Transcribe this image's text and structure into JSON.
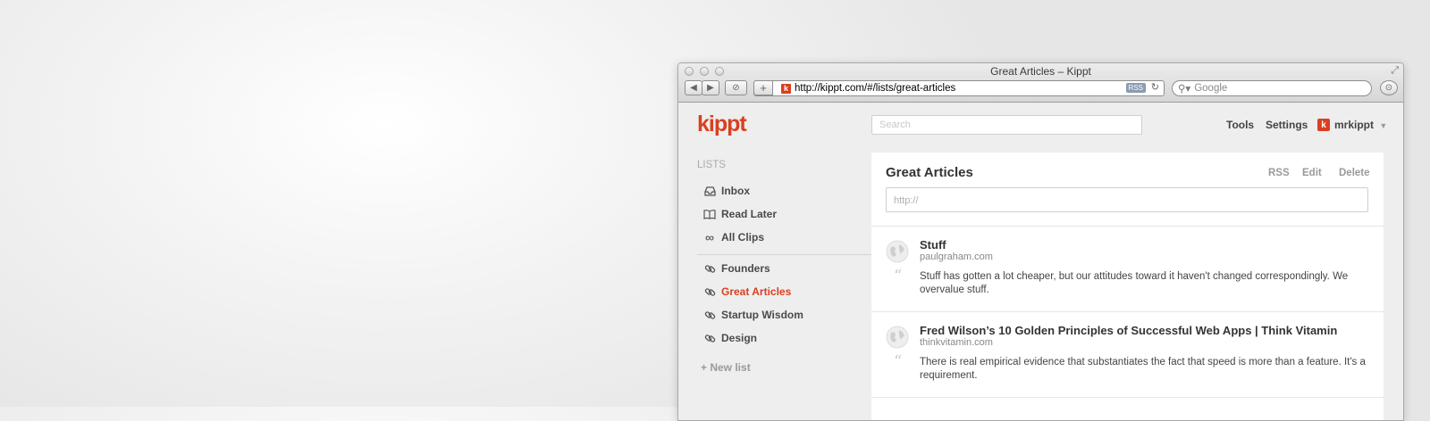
{
  "browser": {
    "window_title": "Great Articles – Kippt",
    "url": "http://kippt.com/#/lists/great-articles",
    "rss_badge": "RSS",
    "search_placeholder": "Google",
    "new_tab_label": "+",
    "icons": [
      "back-icon",
      "forward-icon",
      "reader-icon",
      "reload-icon",
      "downloads-icon",
      "resize-icon",
      "magnifier-icon"
    ]
  },
  "app": {
    "logo": "kippt",
    "search_placeholder": "Search",
    "nav": {
      "tools": "Tools",
      "settings": "Settings",
      "username": "mrkippt",
      "avatar_letter": "k"
    },
    "accent_color": "#d8401f"
  },
  "sidebar": {
    "heading": "LISTS",
    "system_lists": [
      {
        "label": "Inbox",
        "icon": "inbox-icon"
      },
      {
        "label": "Read Later",
        "icon": "book-icon"
      },
      {
        "label": "All Clips",
        "icon": "infinity-icon"
      }
    ],
    "user_lists": [
      {
        "label": "Founders",
        "icon": "link-icon"
      },
      {
        "label": "Great Articles",
        "icon": "link-icon",
        "active": true
      },
      {
        "label": "Startup Wisdom",
        "icon": "link-icon"
      },
      {
        "label": "Design",
        "icon": "link-icon"
      }
    ],
    "new_list": "+ New list"
  },
  "main": {
    "title": "Great Articles",
    "actions": {
      "rss": "RSS",
      "edit": "Edit",
      "delete": "Delete"
    },
    "url_placeholder": "http://",
    "clips": [
      {
        "title": "Stuff",
        "domain": "paulgraham.com",
        "quote": "Stuff has gotten a lot cheaper, but our attitudes toward it haven't changed correspondingly. We overvalue stuff."
      },
      {
        "title": "Fred Wilson’s 10 Golden Principles of Successful Web Apps | Think Vitamin",
        "domain": "thinkvitamin.com",
        "quote": "There is real empirical evidence that substantiates the fact that speed is more than a feature. It's a requirement."
      }
    ]
  }
}
